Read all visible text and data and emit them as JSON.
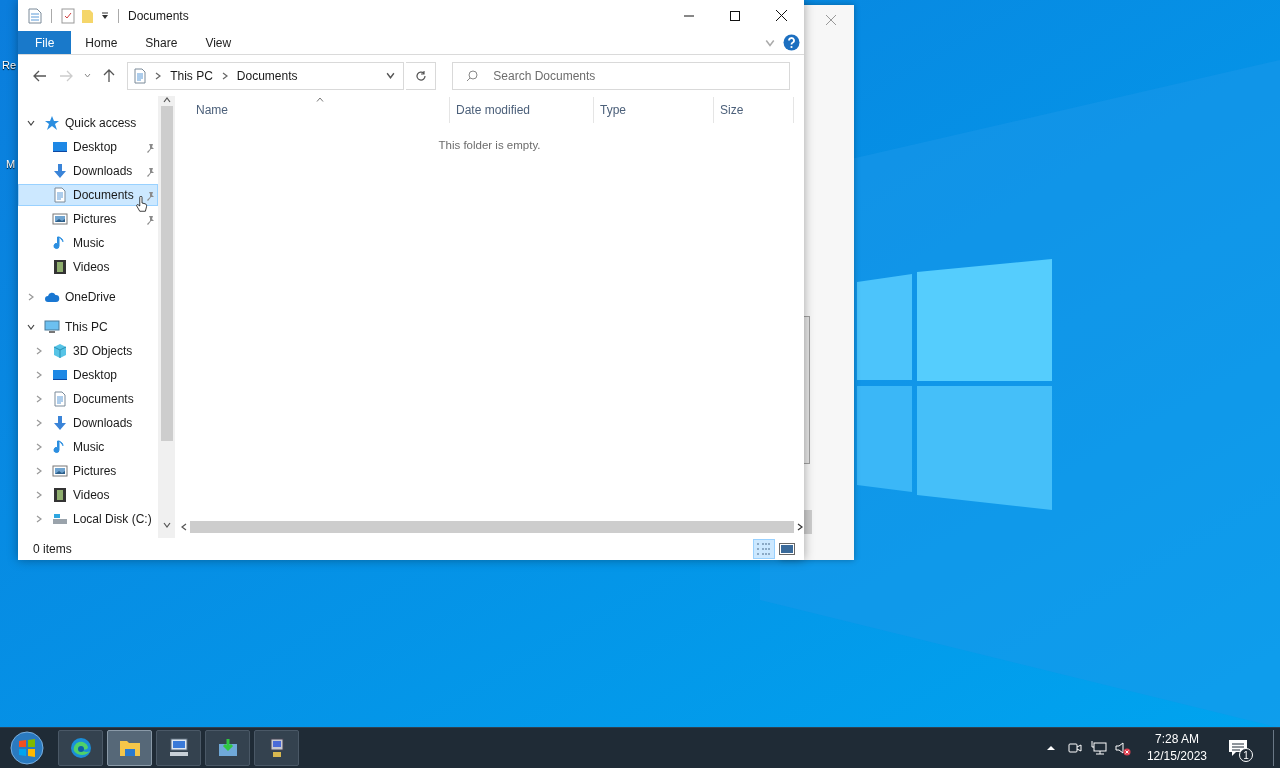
{
  "desktop": {
    "icon_labels": [
      "Re",
      "M"
    ]
  },
  "window": {
    "title": "Documents",
    "ribbon_tabs": [
      {
        "label": "File",
        "kind": "file"
      },
      {
        "label": "Home",
        "kind": "tab"
      },
      {
        "label": "Share",
        "kind": "tab"
      },
      {
        "label": "View",
        "kind": "tab"
      }
    ],
    "address": {
      "breadcrumb": [
        "This PC",
        "Documents"
      ]
    },
    "search": {
      "placeholder": "Search Documents"
    },
    "nav_tree": [
      {
        "label": "Quick access",
        "kind": "star",
        "expanded": true,
        "selected": false,
        "children": [
          {
            "label": "Desktop",
            "kind": "desktop",
            "pinned": true,
            "selected": false
          },
          {
            "label": "Downloads",
            "kind": "downloads",
            "pinned": true,
            "selected": false
          },
          {
            "label": "Documents",
            "kind": "documents",
            "pinned": true,
            "selected": true
          },
          {
            "label": "Pictures",
            "kind": "pictures",
            "pinned": true,
            "selected": false
          },
          {
            "label": "Music",
            "kind": "music",
            "pinned": false,
            "selected": false
          },
          {
            "label": "Videos",
            "kind": "videos",
            "pinned": false,
            "selected": false
          }
        ]
      },
      {
        "label": "OneDrive",
        "kind": "cloud",
        "expanded": false,
        "selected": false
      },
      {
        "label": "This PC",
        "kind": "pc",
        "expanded": true,
        "selected": false,
        "children": [
          {
            "label": "3D Objects",
            "kind": "cube",
            "expanded": false,
            "selected": false
          },
          {
            "label": "Desktop",
            "kind": "desktop",
            "expanded": false,
            "selected": false
          },
          {
            "label": "Documents",
            "kind": "documents",
            "expanded": false,
            "selected": false
          },
          {
            "label": "Downloads",
            "kind": "downloads",
            "expanded": false,
            "selected": false
          },
          {
            "label": "Music",
            "kind": "music",
            "expanded": false,
            "selected": false
          },
          {
            "label": "Pictures",
            "kind": "pictures",
            "expanded": false,
            "selected": false
          },
          {
            "label": "Videos",
            "kind": "videos",
            "expanded": false,
            "selected": false
          },
          {
            "label": "Local Disk (C:)",
            "kind": "disk",
            "expanded": false,
            "selected": false
          }
        ]
      }
    ],
    "columns": [
      "Name",
      "Date modified",
      "Type",
      "Size"
    ],
    "empty_message": "This folder is empty.",
    "status_bar": {
      "item_count": "0 items",
      "views": [
        {
          "kind": "details",
          "selected": true
        },
        {
          "kind": "large-icons",
          "selected": false
        }
      ]
    }
  },
  "taskbar": {
    "apps": [
      {
        "kind": "edge",
        "selected": false
      },
      {
        "kind": "explorer",
        "selected": true
      },
      {
        "kind": "remote",
        "selected": false
      },
      {
        "kind": "transfer",
        "selected": false
      },
      {
        "kind": "computer",
        "selected": false
      }
    ],
    "clock": {
      "time": "7:28 AM",
      "date": "12/15/2023"
    },
    "notifications": "1"
  }
}
